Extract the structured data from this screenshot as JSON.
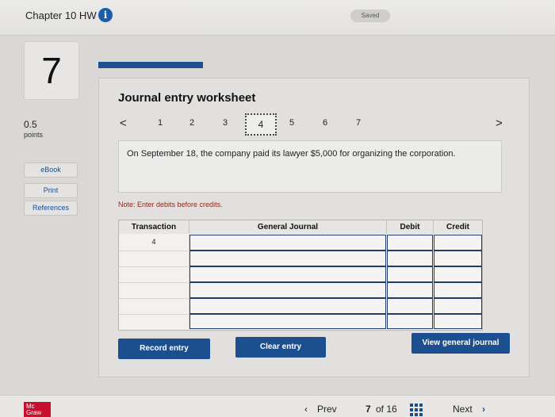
{
  "header": {
    "title": "Chapter 10 HW",
    "info_icon": "i",
    "saved_label": "Saved"
  },
  "question": {
    "number": "7",
    "points_value": "0.5",
    "points_label": "points",
    "progress_fraction": 0.25
  },
  "side_buttons": [
    "eBook",
    "Print",
    "References"
  ],
  "worksheet": {
    "title": "Journal entry worksheet",
    "nav": {
      "prev": "<",
      "next": ">",
      "items": [
        "1",
        "2",
        "3",
        "4",
        "5",
        "6",
        "7"
      ],
      "current_index": 3
    },
    "description": "On September 18, the company paid its lawyer $5,000 for organizing the corporation.",
    "note": "Note: Enter debits before credits.",
    "table": {
      "headers": [
        "Transaction",
        "General Journal",
        "Debit",
        "Credit"
      ],
      "rows": [
        [
          "4",
          "",
          "",
          ""
        ],
        [
          "",
          "",
          "",
          ""
        ],
        [
          "",
          "",
          "",
          ""
        ],
        [
          "",
          "",
          "",
          ""
        ],
        [
          "",
          "",
          "",
          ""
        ],
        [
          "",
          "",
          "",
          ""
        ]
      ]
    },
    "buttons": {
      "record": "Record entry",
      "clear": "Clear entry",
      "view": "View general journal"
    }
  },
  "footer": {
    "logo_text": "Mc Graw",
    "prev": "Prev",
    "page": "7",
    "of_label": "of 16",
    "next": "Next"
  },
  "colors": {
    "primary": "#1c4f8f",
    "note": "#8a2a1f",
    "logo": "#c8102e"
  }
}
